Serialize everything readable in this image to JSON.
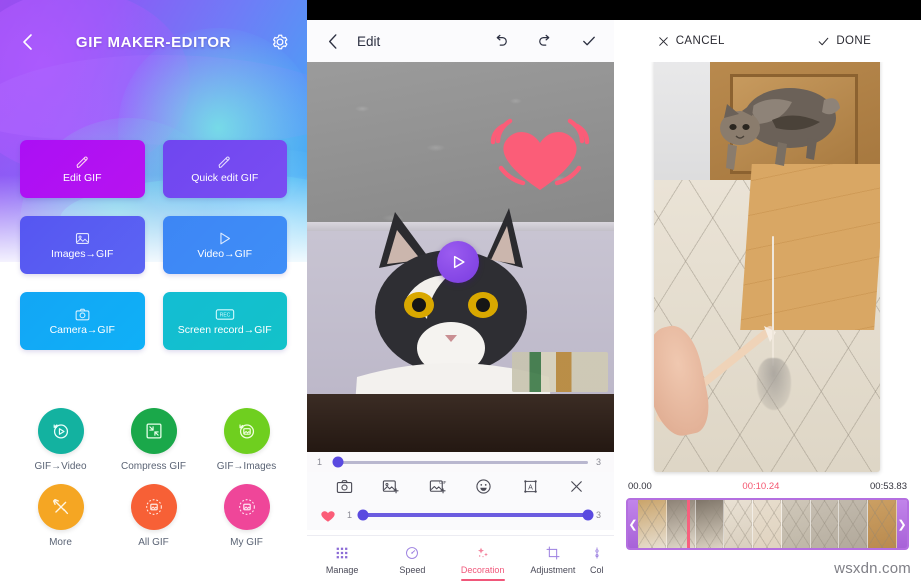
{
  "home": {
    "header": {
      "back_icon": "chevron-left-icon",
      "title": "GIF MAKER-EDITOR",
      "settings_icon": "gear-icon"
    },
    "tiles": [
      {
        "label": "Edit GIF",
        "icon": "brush-icon",
        "color": "#ab0ff5"
      },
      {
        "label": "Quick edit GIF",
        "icon": "brush-icon",
        "color": "#6f46f0"
      },
      {
        "label": "Images→GIF",
        "icon": "image-icon",
        "color": "#5656f2"
      },
      {
        "label": "Video→GIF",
        "icon": "play-icon",
        "color": "#3d86f5"
      },
      {
        "label": "Camera→GIF",
        "icon": "camera-icon",
        "color": "#13a6f5"
      },
      {
        "label": "Screen record→GIF",
        "icon": "rec-icon",
        "color": "#13bdd3"
      }
    ],
    "circles": [
      {
        "label": "GIF→Video",
        "icon": "play-refresh-icon",
        "color": "#13b2a0"
      },
      {
        "label": "Compress GIF",
        "icon": "compress-icon",
        "color": "#1aa84a"
      },
      {
        "label": "GIF→Images",
        "icon": "image-refresh-icon",
        "color": "#6fcf1f"
      },
      {
        "label": "More",
        "icon": "tools-icon",
        "color": "#f5a623"
      },
      {
        "label": "All GIF",
        "icon": "gallery-icon",
        "color": "#f76036"
      },
      {
        "label": "My GIF",
        "icon": "gallery-icon",
        "color": "#ef4699"
      }
    ]
  },
  "edit": {
    "header": {
      "back_icon": "chevron-left-icon",
      "title": "Edit",
      "undo_icon": "undo-icon",
      "redo_icon": "redo-icon",
      "confirm_icon": "check-icon"
    },
    "canvas": {
      "sticker": "heart-sticker",
      "play_icon": "play-icon"
    },
    "frame_slider": {
      "min_label": "1",
      "max_label": "3",
      "value": 1,
      "percent": 2
    },
    "tools": [
      {
        "icon": "camera-icon",
        "name": "capture-frame"
      },
      {
        "icon": "add-image-icon",
        "name": "add-image"
      },
      {
        "icon": "add-gif-icon",
        "name": "add-gif"
      },
      {
        "icon": "emoji-icon",
        "name": "add-sticker"
      },
      {
        "icon": "text-box-icon",
        "name": "add-text"
      },
      {
        "icon": "close-icon",
        "name": "delete-layer"
      }
    ],
    "sticker_slider": {
      "min_label": "1",
      "max_label": "3",
      "value": 3,
      "percent": 100,
      "thumbnail": "heart-sticker"
    },
    "nav": [
      {
        "label": "Manage",
        "icon": "grid-icon",
        "active": false
      },
      {
        "label": "Speed",
        "icon": "speedometer-icon",
        "active": false
      },
      {
        "label": "Decoration",
        "icon": "sparkle-icon",
        "active": true
      },
      {
        "label": "Adjustment",
        "icon": "crop-icon",
        "active": false
      },
      {
        "label": "Col",
        "icon": "sliders-icon",
        "active": false
      }
    ],
    "accent_color": "#f0577a"
  },
  "trim": {
    "header": {
      "cancel_label": "CANCEL",
      "cancel_icon": "close-icon",
      "done_label": "DONE",
      "done_icon": "check-icon"
    },
    "timeline": {
      "start_time": "00.00",
      "current_time": "00:10.24",
      "end_time": "00:53.83",
      "current_color": "#f4566f",
      "handle_color": "#b46fe0",
      "playhead_percent": 19,
      "frames": 9
    }
  },
  "watermark": "wsxdn.com"
}
